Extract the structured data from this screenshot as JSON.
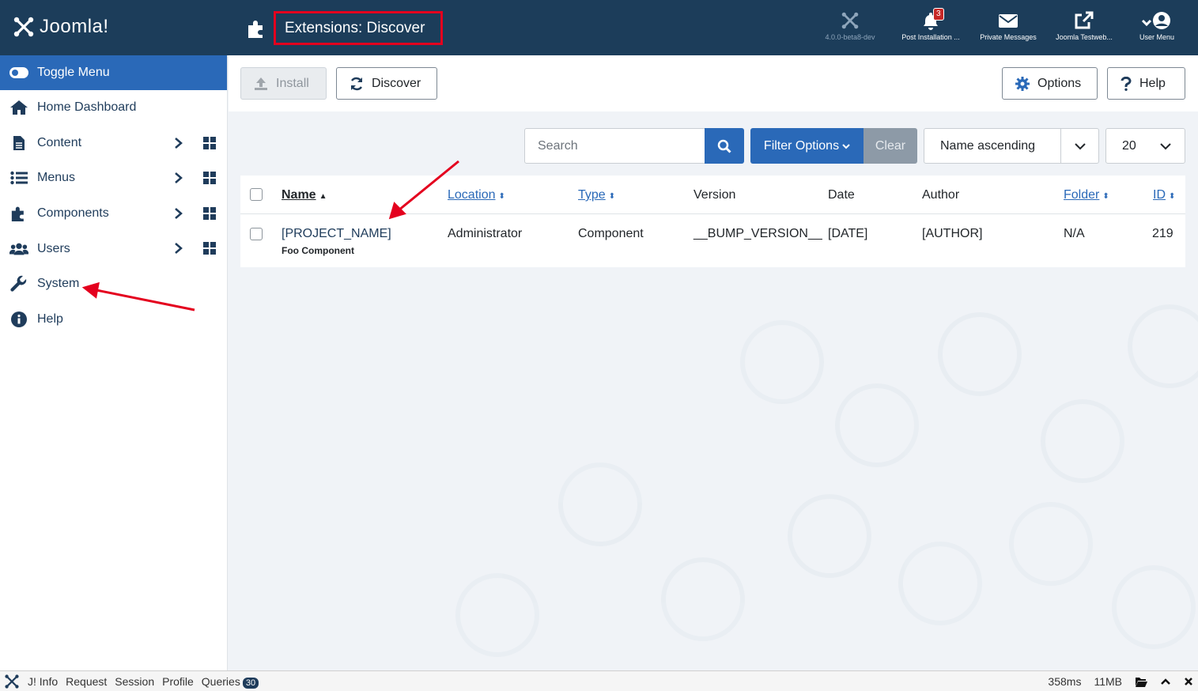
{
  "header": {
    "logo_text": "Joomla!",
    "page_title": "Extensions: Discover",
    "items": [
      {
        "label": "4.0.0-beta8-dev",
        "icon": "joomla-icon"
      },
      {
        "label": "Post Installation ...",
        "icon": "bell-icon",
        "badge": "3"
      },
      {
        "label": "Private Messages",
        "icon": "envelope-icon"
      },
      {
        "label": "Joomla Testweb...",
        "icon": "external-link-icon"
      },
      {
        "label": "User Menu",
        "icon": "user-circle-icon"
      }
    ]
  },
  "sidebar": {
    "toggle_label": "Toggle Menu",
    "items": [
      {
        "label": "Home Dashboard",
        "icon": "home-icon"
      },
      {
        "label": "Content",
        "icon": "file-icon"
      },
      {
        "label": "Menus",
        "icon": "list-icon"
      },
      {
        "label": "Components",
        "icon": "puzzle-icon"
      },
      {
        "label": "Users",
        "icon": "users-icon"
      },
      {
        "label": "System",
        "icon": "wrench-icon"
      },
      {
        "label": "Help",
        "icon": "info-icon"
      }
    ]
  },
  "toolbar": {
    "install_label": "Install",
    "discover_label": "Discover",
    "options_label": "Options",
    "help_label": "Help"
  },
  "filters": {
    "search_placeholder": "Search",
    "filter_options_label": "Filter Options",
    "clear_label": "Clear",
    "ordering_value": "Name ascending",
    "limit_value": "20"
  },
  "table": {
    "columns": [
      "Name",
      "Location",
      "Type",
      "Version",
      "Date",
      "Author",
      "Folder",
      "ID"
    ],
    "rows": [
      {
        "name": "[PROJECT_NAME]",
        "subname": "Foo Component",
        "location": "Administrator",
        "type": "Component",
        "version": "__BUMP_VERSION__",
        "date": "[DATE]",
        "author": "[AUTHOR]",
        "folder": "N/A",
        "id": "219"
      }
    ]
  },
  "debug": {
    "items": [
      "J! Info",
      "Request",
      "Session",
      "Profile",
      "Queries"
    ],
    "queries_count": "30",
    "time": "358ms",
    "memory": "11MB"
  },
  "colors": {
    "header_bg": "#1c3d5a",
    "primary": "#2a69b8",
    "annotation": "#e4001e"
  }
}
